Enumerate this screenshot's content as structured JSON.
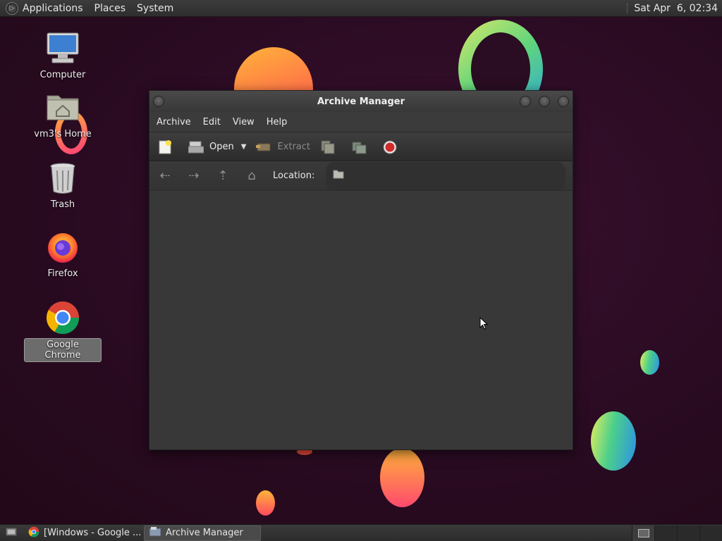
{
  "top_panel": {
    "menus": [
      "Applications",
      "Places",
      "System"
    ],
    "clock": "Sat Apr  6, 02:34"
  },
  "desktop_icons": [
    {
      "label": "Computer",
      "icon": "computer-icon"
    },
    {
      "label": "vm3's Home",
      "icon": "home-folder-icon"
    },
    {
      "label": "Trash",
      "icon": "trash-icon"
    },
    {
      "label": "Firefox",
      "icon": "firefox-icon"
    },
    {
      "label": "Google Chrome",
      "icon": "chrome-icon",
      "selected": true
    }
  ],
  "window": {
    "title": "Archive Manager",
    "menubar": [
      "Archive",
      "Edit",
      "View",
      "Help"
    ],
    "toolbar": {
      "new_icon": "new-archive-icon",
      "open_label": "Open",
      "extract_label": "Extract",
      "add_files_icon": "add-files-icon",
      "add_folder_icon": "add-folder-icon",
      "stop_icon": "stop-icon"
    },
    "location": {
      "label": "Location:",
      "value": ""
    }
  },
  "bottom_panel": {
    "tasks": [
      {
        "label": "[Windows - Google ...",
        "icon": "chrome-icon",
        "active": false
      },
      {
        "label": "Archive Manager",
        "icon": "archive-manager-icon",
        "active": true
      }
    ]
  },
  "colors": {
    "desktop_bg": "#2a0d22",
    "panel_bg": "#333333",
    "window_bg": "#3a3a3a",
    "stop_red": "#d02a2a"
  }
}
